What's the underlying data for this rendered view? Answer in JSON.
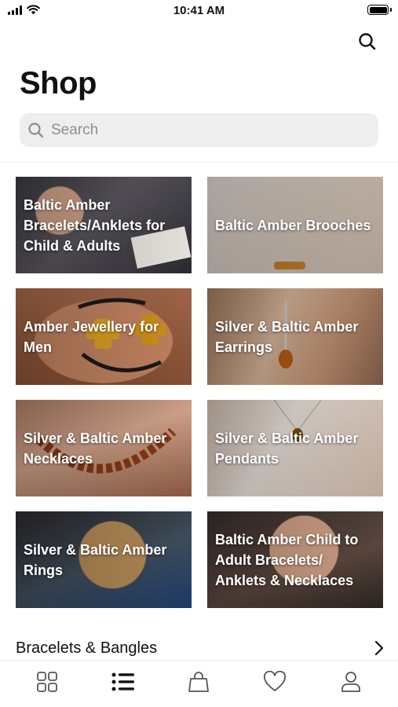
{
  "status_bar": {
    "time": "10:41 AM"
  },
  "header": {
    "title": "Shop"
  },
  "search": {
    "placeholder": "Search"
  },
  "categories": [
    {
      "label": "Baltic Amber Bracelets/Anklets for Child & Adults"
    },
    {
      "label": "Baltic Amber Brooches"
    },
    {
      "label": "Amber Jewellery for Men"
    },
    {
      "label": "Silver & Baltic Amber Earrings"
    },
    {
      "label": "Silver & Baltic Amber Necklaces"
    },
    {
      "label": "Silver & Baltic Amber Pendants"
    },
    {
      "label": "Silver & Baltic Amber Rings"
    },
    {
      "label": "Baltic Amber Child to Adult Bracelets/ Anklets & Necklaces"
    }
  ],
  "section": {
    "title": "Bracelets & Bangles",
    "icon": "chevron-right-icon"
  },
  "tab_bar": {
    "items": [
      {
        "icon": "grid-icon"
      },
      {
        "icon": "list-icon",
        "active": true
      },
      {
        "icon": "bag-icon"
      },
      {
        "icon": "heart-icon"
      },
      {
        "icon": "profile-icon"
      }
    ]
  },
  "colors": {
    "accent": "#000000",
    "search_bg": "#eeeeef",
    "placeholder": "#8e8e93"
  }
}
